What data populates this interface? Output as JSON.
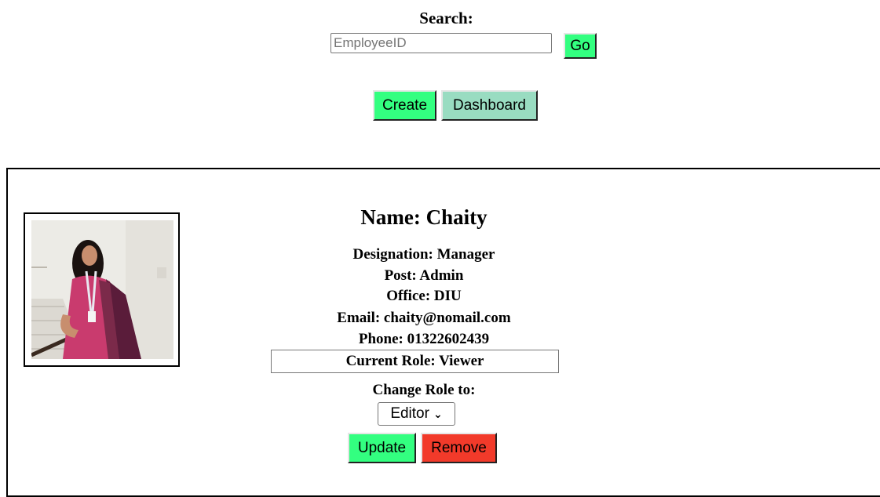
{
  "search": {
    "title": "Search:",
    "placeholder": "EmployeeID",
    "value": "",
    "go_label": "Go"
  },
  "actions": {
    "create_label": "Create",
    "dashboard_label": "Dashboard"
  },
  "employee": {
    "name_line": "Name: Chaity",
    "designation": "Designation: Manager",
    "post": "Post: Admin",
    "office": "Office: DIU",
    "email": "Email: chaity@nomail.com",
    "phone": "Phone: 01322602439",
    "current_role": "Current Role: Viewer",
    "change_role_label": "Change Role to:",
    "role_selected": "Editor",
    "update_label": "Update",
    "remove_label": "Remove"
  },
  "colors": {
    "green_button": "#33ff80",
    "dashboard_button": "#99dcc1",
    "remove_button": "#f23a2a"
  }
}
